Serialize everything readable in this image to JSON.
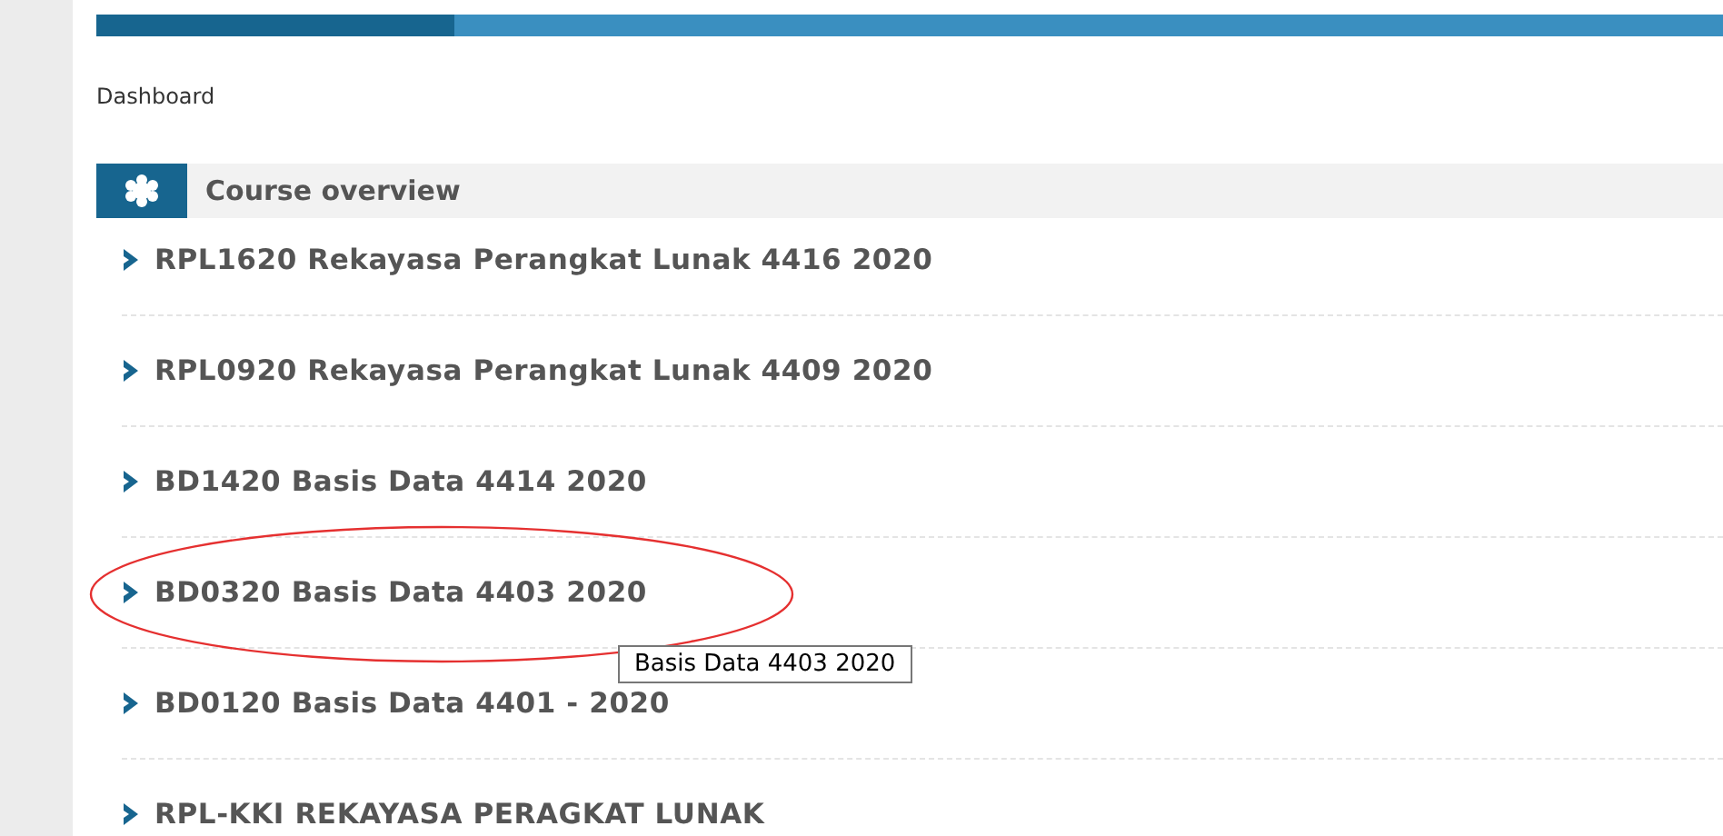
{
  "breadcrumb": "Dashboard",
  "block": {
    "title": "Course overview"
  },
  "courses": [
    {
      "name": "RPL1620 Rekayasa Perangkat Lunak 4416 2020",
      "highlighted": false
    },
    {
      "name": "RPL0920 Rekayasa Perangkat Lunak 4409 2020",
      "highlighted": false
    },
    {
      "name": "BD1420 Basis Data 4414 2020",
      "highlighted": false
    },
    {
      "name": "BD0320 Basis Data 4403 2020",
      "highlighted": true
    },
    {
      "name": "BD0120 Basis Data 4401 - 2020",
      "highlighted": false
    },
    {
      "name": "RPL-KKI REKAYASA PERAGKAT LUNAK",
      "highlighted": false
    }
  ],
  "tooltip": {
    "text": "Basis Data 4403 2020"
  }
}
